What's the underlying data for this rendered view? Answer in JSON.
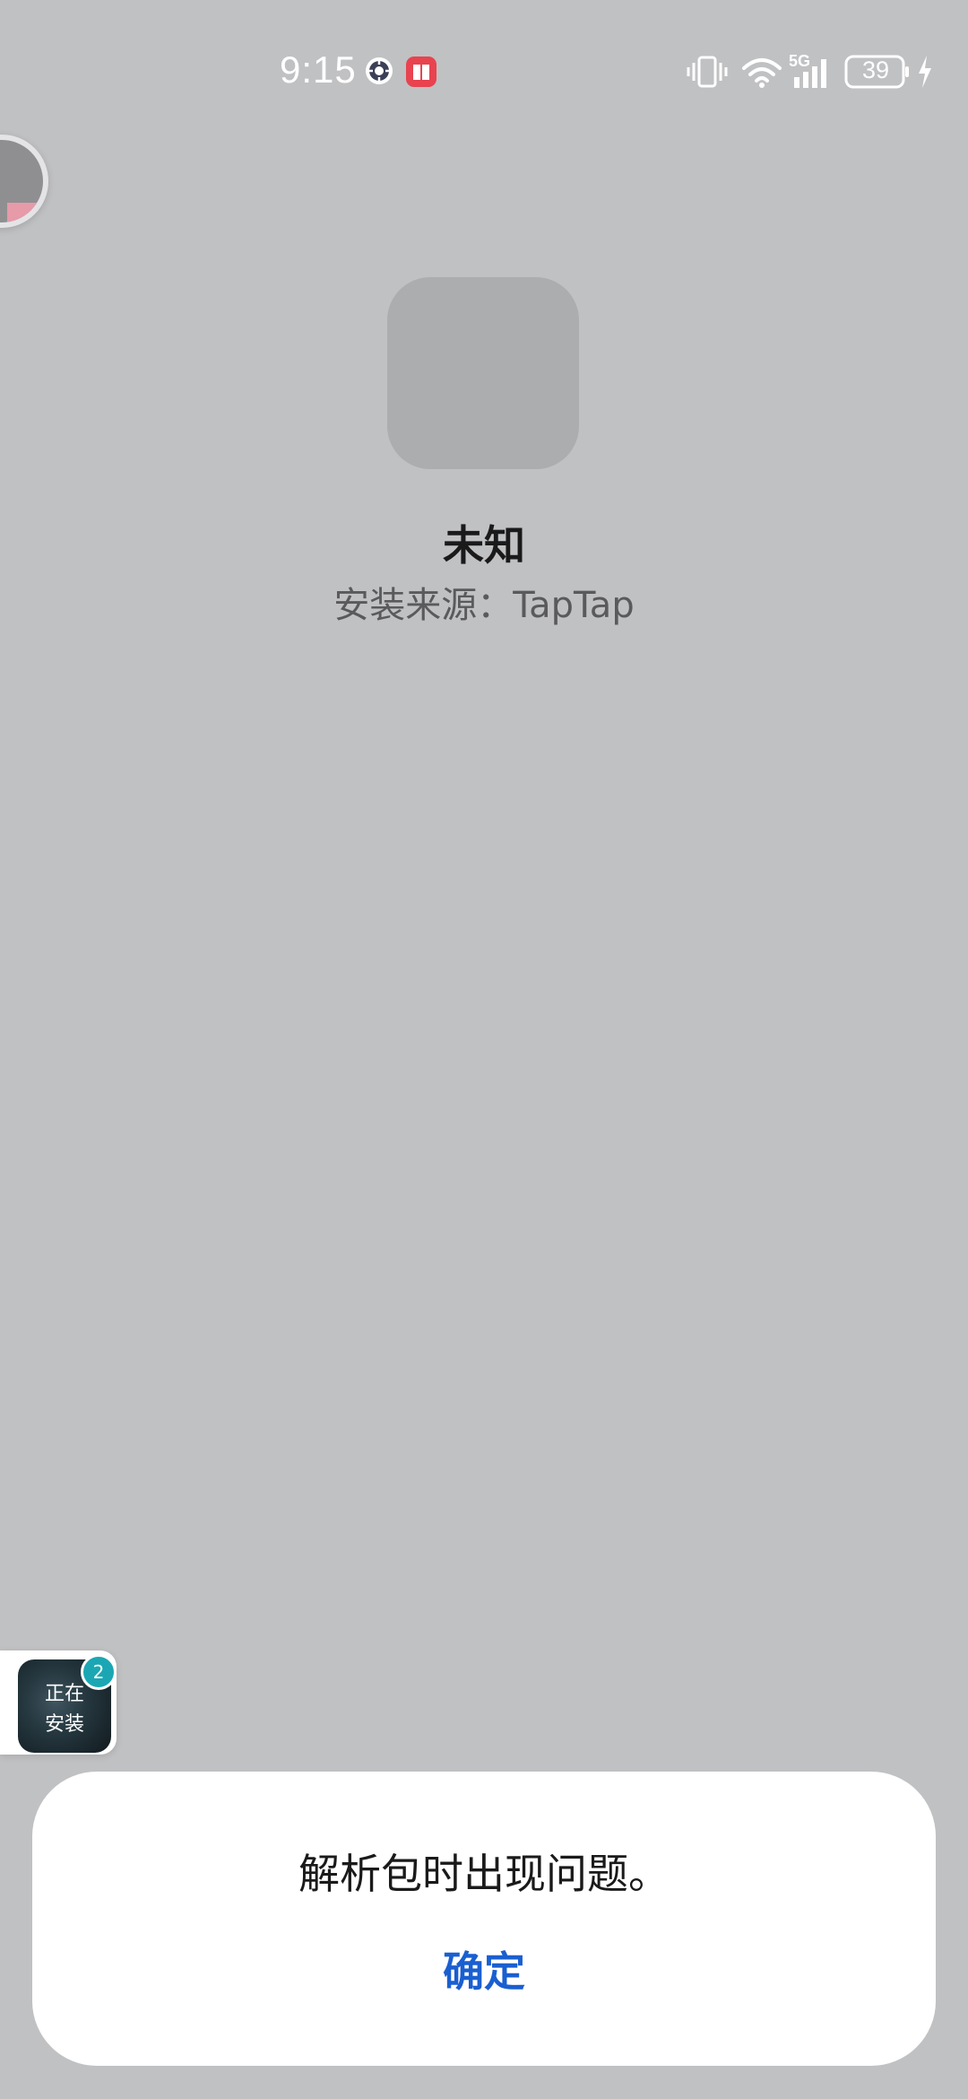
{
  "status_bar": {
    "time": "9:15",
    "battery_level": "39",
    "network_label": "5G",
    "icons": [
      "settings-gear-icon",
      "book-app-icon",
      "vibrate-icon",
      "wifi-icon",
      "5g-signal-icon",
      "battery-icon",
      "charging-icon"
    ],
    "colors": {
      "book_icon": "#e8434f",
      "text": "#ffffff"
    }
  },
  "app_info": {
    "name": "未知",
    "install_source": "安装来源：TapTap"
  },
  "install_widget": {
    "text": "正在\n安装",
    "badge_count": "2"
  },
  "dialog": {
    "message": "解析包时出现问题。",
    "confirm_label": "确定",
    "colors": {
      "confirm": "#1a5fd0"
    }
  },
  "colors": {
    "background": "#c0c1c3",
    "icon_placeholder": "#acadaf"
  }
}
